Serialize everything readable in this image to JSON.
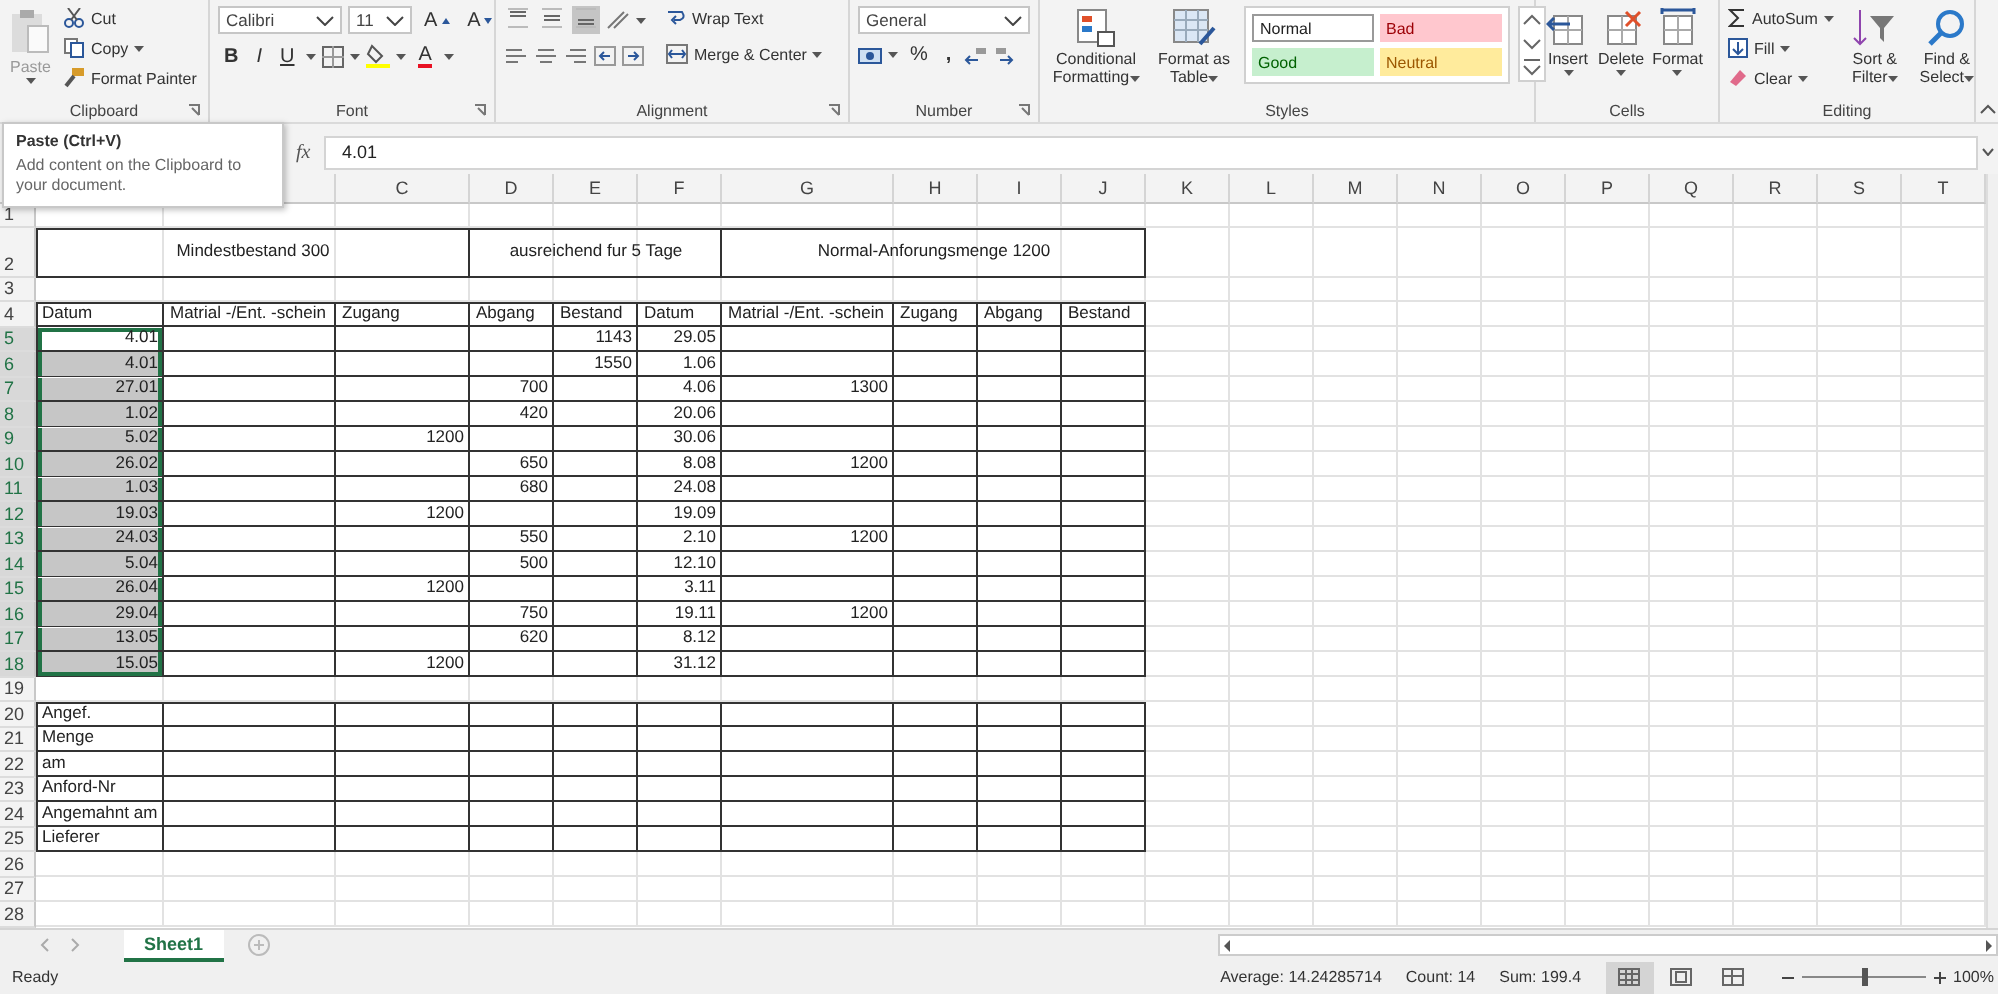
{
  "ribbon": {
    "clipboard": {
      "label": "Clipboard",
      "paste": {
        "label": "Paste",
        "disabled": true
      },
      "cut": "Cut",
      "copy": "Copy",
      "format_painter": "Format Painter"
    },
    "font": {
      "label": "Font",
      "name": "Calibri",
      "size": "11",
      "grow": "A",
      "shrink": "A",
      "bold": "B",
      "italic": "I",
      "underline": "U",
      "font_color": "A"
    },
    "alignment": {
      "label": "Alignment",
      "wrap_text": "Wrap Text",
      "merge": "Merge & Center",
      "vertical_align": [
        {
          "selected": false
        },
        {
          "selected": false
        },
        {
          "selected": true
        }
      ]
    },
    "number": {
      "label": "Number",
      "format": "General",
      "percent": "%",
      "comma": ","
    },
    "styles": {
      "label": "Styles",
      "conditional": "Conditional Formatting",
      "format_table": "Format as Table",
      "cell_styles": [
        {
          "label": "Normal",
          "kind": "normal"
        },
        {
          "label": "Bad",
          "kind": "bad"
        },
        {
          "label": "Good",
          "kind": "good"
        },
        {
          "label": "Neutral",
          "kind": "neutral"
        }
      ]
    },
    "cells": {
      "label": "Cells",
      "buttons": [
        "Insert",
        "Delete",
        "Format"
      ]
    },
    "editing": {
      "label": "Editing",
      "autosum": "AutoSum",
      "fill": "Fill",
      "clear": "Clear",
      "sort": "Sort & Filter",
      "find": "Find & Select"
    }
  },
  "tooltip": {
    "title": "Paste (Ctrl+V)",
    "text": "Add content on the Clipboard to your document."
  },
  "formula_bar": {
    "function_button": "fx",
    "value": "4.01"
  },
  "sheet": {
    "columns": [
      "C",
      "D",
      "E",
      "F",
      "G",
      "H",
      "I",
      "J",
      "K",
      "L",
      "M",
      "N",
      "O",
      "P",
      "Q",
      "R",
      "S",
      "T"
    ],
    "rows": [
      {
        "label": "1",
        "selected": false
      },
      {
        "label": "2",
        "selected": false,
        "kind": "banner",
        "cells": [
          "Mindestbestand 300",
          "ausreichend fur 5 Tage",
          "Normal-Anforungsmenge 1200"
        ]
      },
      {
        "label": "3",
        "selected": false
      },
      {
        "label": "4",
        "selected": false,
        "kind": "header",
        "cells": [
          "Datum",
          "Matrial -/Ent. -schein",
          "Zugang",
          "Abgang",
          "Bestand",
          "Datum",
          "Matrial -/Ent. -schein",
          "Zugang",
          "Abgang",
          "Bestand"
        ]
      },
      {
        "label": "5",
        "selected": true,
        "active": true,
        "kind": "data",
        "cells": [
          "4.01",
          null,
          null,
          null,
          "1143",
          "29.05",
          null,
          null,
          null,
          null
        ]
      },
      {
        "label": "6",
        "selected": true,
        "active": false,
        "kind": "data",
        "cells": [
          "4.01",
          null,
          null,
          null,
          "1550",
          "1.06",
          null,
          null,
          null,
          null
        ]
      },
      {
        "label": "7",
        "selected": true,
        "active": false,
        "kind": "data",
        "cells": [
          "27.01",
          null,
          null,
          "700",
          null,
          "4.06",
          "1300",
          null,
          null,
          null
        ]
      },
      {
        "label": "8",
        "selected": true,
        "active": false,
        "kind": "data",
        "cells": [
          "1.02",
          null,
          null,
          "420",
          null,
          "20.06",
          null,
          null,
          null,
          null
        ]
      },
      {
        "label": "9",
        "selected": true,
        "active": false,
        "kind": "data",
        "cells": [
          "5.02",
          null,
          "1200",
          null,
          null,
          "30.06",
          null,
          null,
          null,
          null
        ]
      },
      {
        "label": "10",
        "selected": true,
        "active": false,
        "kind": "data",
        "cells": [
          "26.02",
          null,
          null,
          "650",
          null,
          "8.08",
          "1200",
          null,
          null,
          null
        ]
      },
      {
        "label": "11",
        "selected": true,
        "active": false,
        "kind": "data",
        "cells": [
          "1.03",
          null,
          null,
          "680",
          null,
          "24.08",
          null,
          null,
          null,
          null
        ]
      },
      {
        "label": "12",
        "selected": true,
        "active": false,
        "kind": "data",
        "cells": [
          "19.03",
          null,
          "1200",
          null,
          null,
          "19.09",
          null,
          null,
          null,
          null
        ]
      },
      {
        "label": "13",
        "selected": true,
        "active": false,
        "kind": "data",
        "cells": [
          "24.03",
          null,
          null,
          "550",
          null,
          "2.10",
          "1200",
          null,
          null,
          null
        ]
      },
      {
        "label": "14",
        "selected": true,
        "active": false,
        "kind": "data",
        "cells": [
          "5.04",
          null,
          null,
          "500",
          null,
          "12.10",
          null,
          null,
          null,
          null
        ]
      },
      {
        "label": "15",
        "selected": true,
        "active": false,
        "kind": "data",
        "cells": [
          "26.04",
          null,
          "1200",
          null,
          null,
          "3.11",
          null,
          null,
          null,
          null
        ]
      },
      {
        "label": "16",
        "selected": true,
        "active": false,
        "kind": "data",
        "cells": [
          "29.04",
          null,
          null,
          "750",
          null,
          "19.11",
          "1200",
          null,
          null,
          null
        ]
      },
      {
        "label": "17",
        "selected": true,
        "active": false,
        "kind": "data",
        "cells": [
          "13.05",
          null,
          null,
          "620",
          null,
          "8.12",
          null,
          null,
          null,
          null
        ]
      },
      {
        "label": "18",
        "selected": true,
        "active": false,
        "kind": "data",
        "cells": [
          "15.05",
          null,
          "1200",
          null,
          null,
          "31.12",
          null,
          null,
          null,
          null
        ]
      },
      {
        "label": "19",
        "selected": false
      },
      {
        "label": "20",
        "selected": false,
        "kind": "label",
        "cells": [
          "Angef.",
          null,
          null,
          null,
          null,
          null,
          null,
          null,
          null,
          null
        ]
      },
      {
        "label": "21",
        "selected": false,
        "kind": "label",
        "cells": [
          "Menge",
          null,
          null,
          null,
          null,
          null,
          null,
          null,
          null,
          null
        ]
      },
      {
        "label": "22",
        "selected": false,
        "kind": "label",
        "cells": [
          "am",
          null,
          null,
          null,
          null,
          null,
          null,
          null,
          null,
          null
        ]
      },
      {
        "label": "23",
        "selected": false,
        "kind": "label",
        "cells": [
          "Anford-Nr",
          null,
          null,
          null,
          null,
          null,
          null,
          null,
          null,
          null
        ]
      },
      {
        "label": "24",
        "selected": false,
        "kind": "label",
        "cells": [
          "Angemahnt am",
          null,
          null,
          null,
          null,
          null,
          null,
          null,
          null,
          null
        ]
      },
      {
        "label": "25",
        "selected": false,
        "kind": "label",
        "cells": [
          "Lieferer",
          null,
          null,
          null,
          null,
          null,
          null,
          null,
          null,
          null
        ]
      },
      {
        "label": "26",
        "selected": false
      },
      {
        "label": "27",
        "selected": false
      },
      {
        "label": "28",
        "selected": false
      }
    ]
  },
  "sheet_tabs": [
    {
      "label": "Sheet1",
      "selected": true
    }
  ],
  "status_bar": {
    "status": "Ready",
    "average": "Average: 14.24285714",
    "count": "Count: 14",
    "sum": "Sum: 199.4",
    "views": [
      {
        "selected": true
      },
      {
        "selected": false
      },
      {
        "selected": false
      }
    ],
    "zoom": {
      "level": 0.5
    },
    "zoom_label": "100%"
  }
}
